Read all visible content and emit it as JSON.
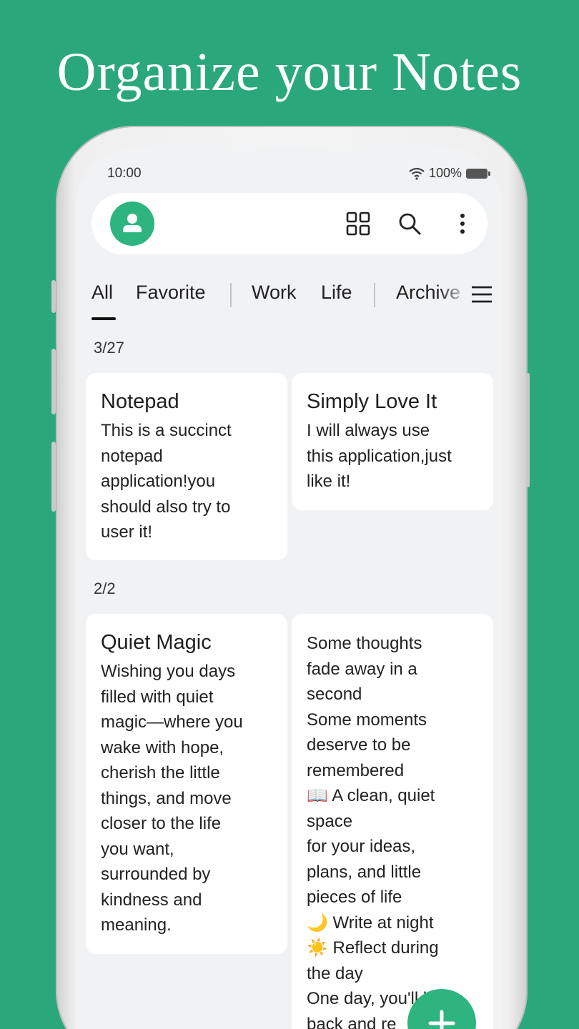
{
  "headline": "Organize your Notes",
  "status": {
    "time": "10:00",
    "battery": "100%"
  },
  "toolbar": {
    "avatar_icon": "user-icon",
    "grid_icon": "grid-view-icon",
    "search_icon": "search-icon",
    "more_icon": "more-vertical-icon"
  },
  "tabs": [
    "All",
    "Favorite",
    "Work",
    "Life",
    "Archive"
  ],
  "groups": [
    {
      "label": "3/27",
      "notes": [
        {
          "title": "Notepad",
          "body": "This is a succinct\nnotepad\napplication!you\nshould also try to\nuser it!"
        },
        {
          "title": "Simply Love It",
          "body": "I will always use\nthis application,just\nlike it!"
        }
      ]
    },
    {
      "label": "2/2",
      "notes": [
        {
          "title": "Quiet Magic",
          "body": "Wishing you days\nfilled with quiet\nmagic—where you\nwake with hope,\ncherish the little\nthings, and move\ncloser to the life\nyou want,\nsurrounded by\nkindness and\nmeaning."
        },
        {
          "title": "",
          "body": "Some thoughts\nfade away in a\nsecond\nSome moments\ndeserve to be\nremembered\n📖 A clean, quiet\nspace\nfor your ideas,\nplans, and little\npieces of life\n🌙 Write at night\n☀️ Reflect during\nthe day\nOne day, you'll look\nback and re"
        }
      ]
    }
  ],
  "fab_icon": "plus-icon",
  "colors": {
    "background": "#2aa87c",
    "accent": "#2eb57f",
    "screen": "#f1f2f4"
  }
}
